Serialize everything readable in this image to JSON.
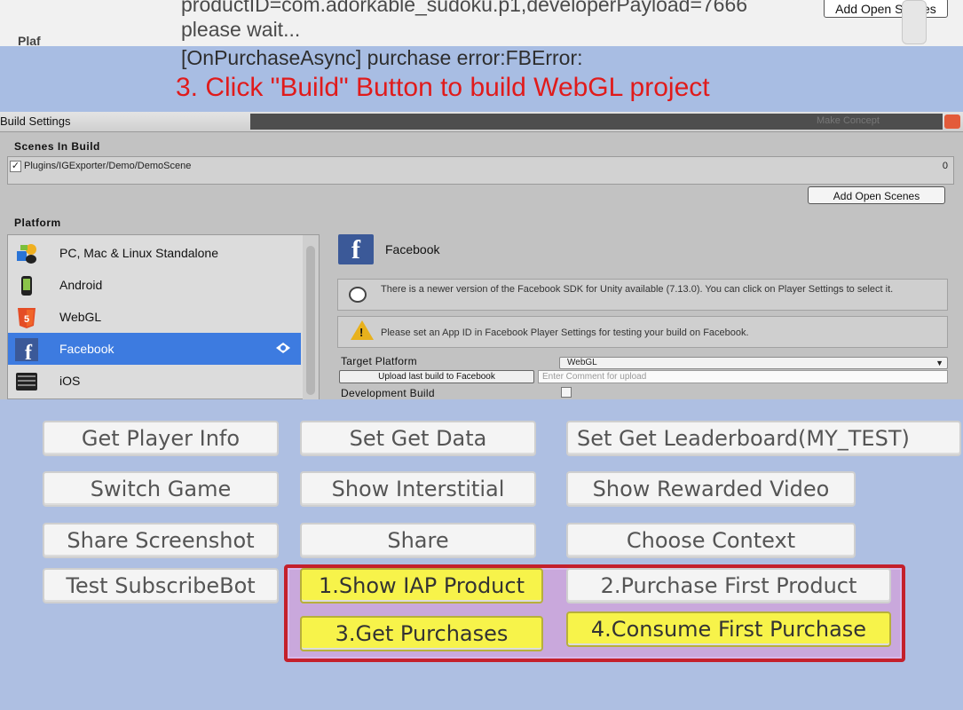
{
  "log": {
    "line1": "productID=com.adorkable_sudoku.p1,developerPayload=7666",
    "line2": "please wait...",
    "left_fragment": "Plaf",
    "top_button": "Add Open Scenes",
    "band_line": "[OnPurchaseAsync] purchase error:FBError:"
  },
  "instruction": "3. Click \"Build\" Button to build WebGL project",
  "build_settings": {
    "title": "Build Settings",
    "title_right": "Make Concept",
    "scenes_label": "Scenes In Build",
    "scene_path": "Plugins/IGExporter/Demo/DemoScene",
    "scene_index": "0",
    "scene_checked": "✓",
    "add_open_scenes": "Add Open Scenes",
    "platform_label": "Platform",
    "platforms": [
      {
        "label": "PC, Mac & Linux Standalone",
        "icon": "pc-mac-linux-icon"
      },
      {
        "label": "Android",
        "icon": "android-icon"
      },
      {
        "label": "WebGL",
        "icon": "html5-icon"
      },
      {
        "label": "Facebook",
        "icon": "facebook-icon"
      },
      {
        "label": "iOS",
        "icon": "ios-icon"
      }
    ],
    "selected_platform_header": "Facebook",
    "help_info": "There is a newer version of the Facebook SDK for Unity available (7.13.0). You can click on Player Settings to select it.",
    "help_warning": "Please set an App ID in Facebook Player Settings for testing your build on Facebook.",
    "target_platform_label": "Target Platform",
    "target_platform_value": "WebGL",
    "upload_button": "Upload last build to Facebook",
    "comment_placeholder": "Enter Comment for upload",
    "development_build_label": "Development Build",
    "colors": {
      "selection": "#3d7be0",
      "facebook": "#3b5998",
      "warning": "#e8b11c"
    }
  },
  "buttons": {
    "get_player_info": "Get Player Info",
    "set_get_data": "Set Get Data",
    "set_get_leaderboard": "Set Get Leaderboard(MY_TEST)",
    "switch_game": "Switch Game",
    "show_interstitial": "Show Interstitial",
    "show_rewarded_video": "Show Rewarded Video",
    "share_screenshot": "Share Screenshot",
    "share": "Share",
    "choose_context": "Choose Context",
    "test_subscribe_bot": "Test SubscribeBot",
    "show_iap_product": "1.Show IAP Product",
    "purchase_first_product": "2.Purchase First Product",
    "get_purchases": "3.Get Purchases",
    "consume_first_purchase": "4.Consume First Purchase"
  },
  "colors": {
    "background": "#aebfe2",
    "instruction_red": "#e01b1b",
    "highlight_border": "#c4202b",
    "iap_yellow": "#f7f34a"
  }
}
